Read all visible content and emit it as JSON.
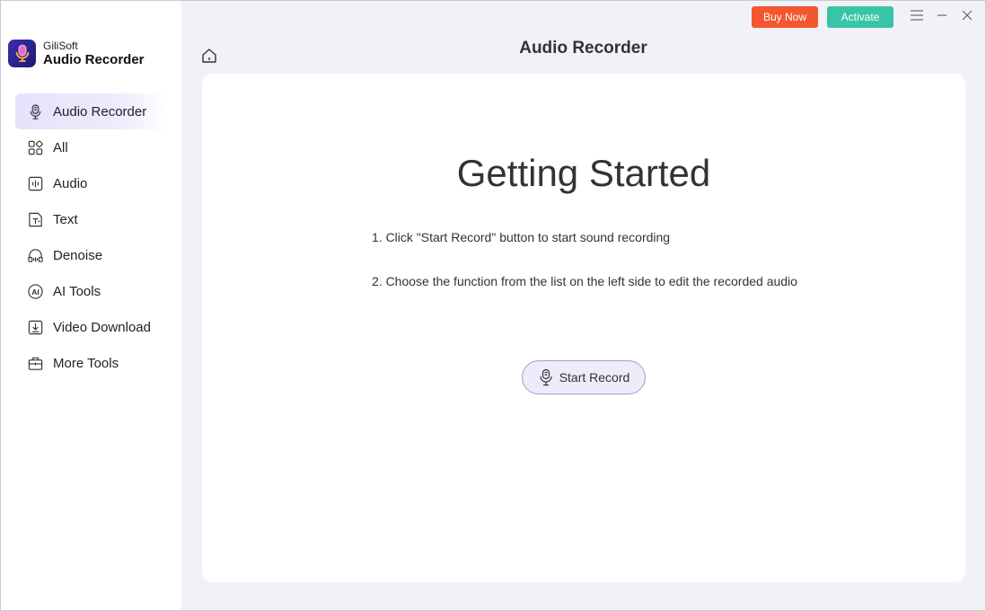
{
  "brand": {
    "company": "GiliSoft",
    "product": "Audio Recorder"
  },
  "titlebar": {
    "buy_label": "Buy Now",
    "activate_label": "Activate",
    "buy_color": "#f4572f",
    "activate_color": "#38c4a6"
  },
  "sidebar": {
    "items": [
      {
        "label": "Audio Recorder",
        "icon": "microphone-icon",
        "active": true
      },
      {
        "label": "All",
        "icon": "grid-icon"
      },
      {
        "label": "Audio",
        "icon": "audio-file-icon"
      },
      {
        "label": "Text",
        "icon": "text-icon"
      },
      {
        "label": "Denoise",
        "icon": "headphones-icon"
      },
      {
        "label": "AI Tools",
        "icon": "ai-icon"
      },
      {
        "label": "Video Download",
        "icon": "download-icon"
      },
      {
        "label": "More Tools",
        "icon": "toolbox-icon"
      }
    ]
  },
  "main": {
    "title": "Audio Recorder",
    "heading": "Getting Started",
    "steps": [
      "1. Click \"Start Record\" button to start sound recording",
      "2. Choose the function from the list on the left side to edit the recorded audio"
    ],
    "start_button_label": "Start Record"
  },
  "colors": {
    "accent": "#6b5bd6",
    "active_nav_bg": "#e6e1fb"
  }
}
